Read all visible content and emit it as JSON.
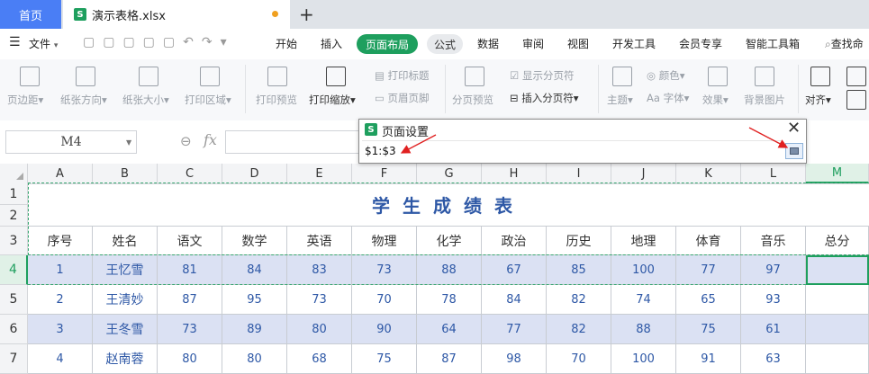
{
  "titlebar": {
    "home_tab": "首页",
    "file_icon": "S",
    "file_name": "演示表格.xlsx",
    "new_tab": "+"
  },
  "menubar": {
    "hamburger": "☰",
    "file": "文件",
    "tabs": [
      "开始",
      "插入",
      "页面布局",
      "公式",
      "数据",
      "审阅",
      "视图",
      "开发工具",
      "会员专享",
      "智能工具箱"
    ],
    "active_tab": "页面布局",
    "search": "查找命"
  },
  "ribbon": {
    "margins": "页边距",
    "orientation": "纸张方向",
    "size": "纸张大小",
    "print_area": "打印区域",
    "print_preview": "打印预览",
    "print_scale": "打印缩放",
    "print_titles": "打印标题",
    "header_footer": "页眉页脚",
    "page_break_preview": "分页预览",
    "show_page_breaks": "显示分页符",
    "insert_page_break": "插入分页符",
    "theme": "主题",
    "colors": "颜色",
    "fonts": "字体",
    "effects": "效果",
    "background": "背景图片",
    "align": "对齐",
    "font_glyph": "Aa"
  },
  "formulabar": {
    "name_box": "M4",
    "fx": "fx"
  },
  "dialog": {
    "icon": "S",
    "title": "页面设置",
    "input_value": "$1:$3",
    "close": "✕"
  },
  "sheet": {
    "columns": [
      "A",
      "B",
      "C",
      "D",
      "E",
      "F",
      "G",
      "H",
      "I",
      "J",
      "K",
      "L",
      "M"
    ],
    "active_column": "M",
    "row_numbers": [
      "1",
      "2",
      "3",
      "4",
      "5",
      "6",
      "7"
    ],
    "title": "学生成绩表",
    "headers": [
      "序号",
      "姓名",
      "语文",
      "数学",
      "英语",
      "物理",
      "化学",
      "政治",
      "历史",
      "地理",
      "体育",
      "音乐",
      "总分"
    ],
    "rows": [
      [
        "1",
        "王忆雪",
        "81",
        "84",
        "83",
        "73",
        "88",
        "67",
        "85",
        "100",
        "77",
        "97",
        ""
      ],
      [
        "2",
        "王清妙",
        "87",
        "95",
        "73",
        "70",
        "78",
        "84",
        "82",
        "74",
        "65",
        "93",
        ""
      ],
      [
        "3",
        "王冬雪",
        "73",
        "89",
        "80",
        "90",
        "64",
        "77",
        "82",
        "88",
        "75",
        "61",
        ""
      ],
      [
        "4",
        "赵南蓉",
        "80",
        "80",
        "68",
        "75",
        "87",
        "98",
        "70",
        "100",
        "91",
        "63",
        ""
      ]
    ]
  },
  "colors": {
    "accent": "#1e9f5e",
    "home_tab": "#4a7ef5",
    "stripe": "#dbe1f3",
    "data_text": "#2e58a6",
    "arrow": "#e02020"
  }
}
